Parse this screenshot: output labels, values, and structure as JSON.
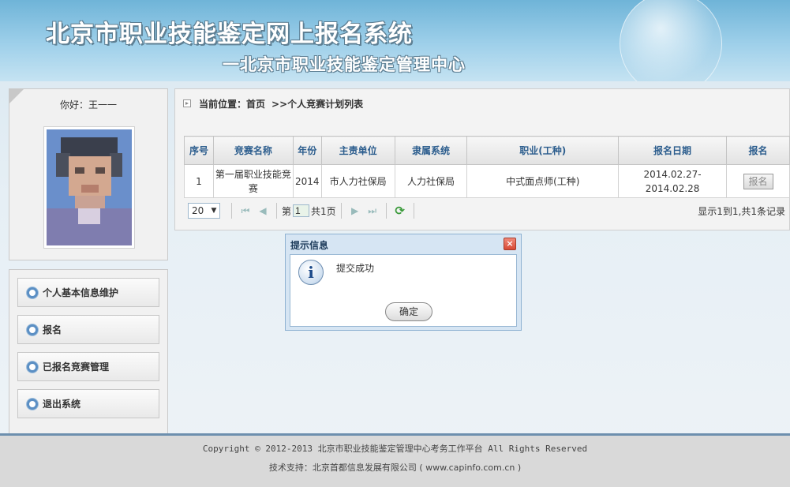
{
  "header": {
    "title": "北京市职业技能鉴定网上报名系统",
    "subtitle": "一北京市职业技能鉴定管理中心"
  },
  "user": {
    "greeting": "你好：王一一"
  },
  "menu": {
    "items": [
      {
        "label": "个人基本信息维护"
      },
      {
        "label": "报名"
      },
      {
        "label": "已报名竞赛管理"
      },
      {
        "label": "退出系统"
      }
    ]
  },
  "breadcrumb": {
    "prefix": "当前位置：首页",
    "current": ">>个人竞赛计划列表"
  },
  "table": {
    "headers": [
      "序号",
      "竞赛名称",
      "年份",
      "主责单位",
      "隶属系统",
      "职业(工种)",
      "报名日期",
      "报名"
    ],
    "rows": [
      {
        "index": "1",
        "name": "第一届职业技能竞赛",
        "year": "2014",
        "unit": "市人力社保局",
        "system": "人力社保局",
        "occupation": "中式面点师(工种)",
        "date": "2014.02.27-2014.02.28",
        "action": "报名"
      }
    ]
  },
  "pager": {
    "page_size": "20",
    "page_prefix": "第",
    "page_value": "1",
    "page_total": "共1页",
    "info": "显示1到1,共1条记录"
  },
  "dialog": {
    "title": "提示信息",
    "close": "×",
    "message": "提交成功",
    "ok": "确定"
  },
  "footer": {
    "copyright": "Copyright © 2012-2013 北京市职业技能鉴定管理中心考务工作平台 All Rights Reserved",
    "support": "技术支持：北京首都信息发展有限公司 ( www.capinfo.com.cn )"
  }
}
